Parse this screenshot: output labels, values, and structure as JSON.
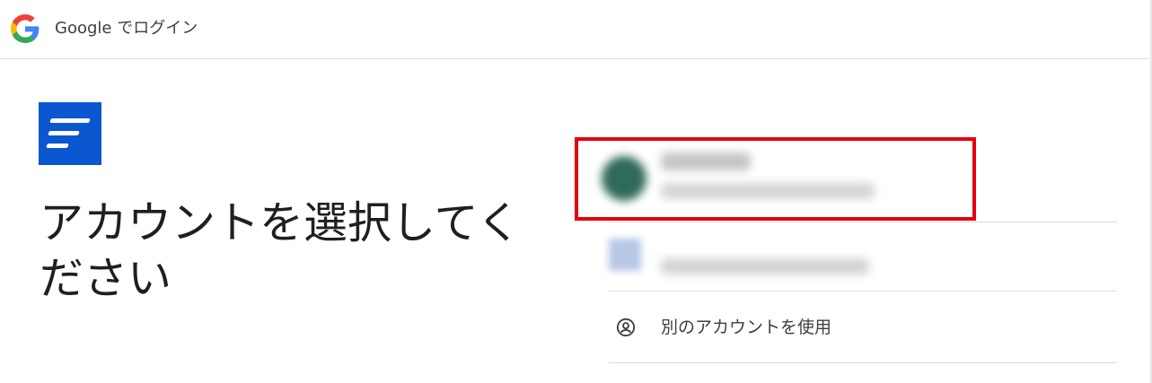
{
  "header": {
    "title": "Google でログイン",
    "logo_icon": "google-g-icon"
  },
  "app": {
    "logo_icon": "app-logo-icon",
    "logo_color": "#0b57d0"
  },
  "main": {
    "title": "アカウントを選択してください"
  },
  "accounts": {
    "items": [
      {
        "avatar_icon": "avatar-round",
        "name": "",
        "email": "",
        "highlighted": true
      },
      {
        "avatar_icon": "avatar-square",
        "name": "",
        "email": ""
      }
    ],
    "use_other_label": "別のアカウントを使用",
    "use_other_icon": "person-circle-icon"
  },
  "colors": {
    "highlight": "#e3000f",
    "divider": "#dadce0"
  }
}
